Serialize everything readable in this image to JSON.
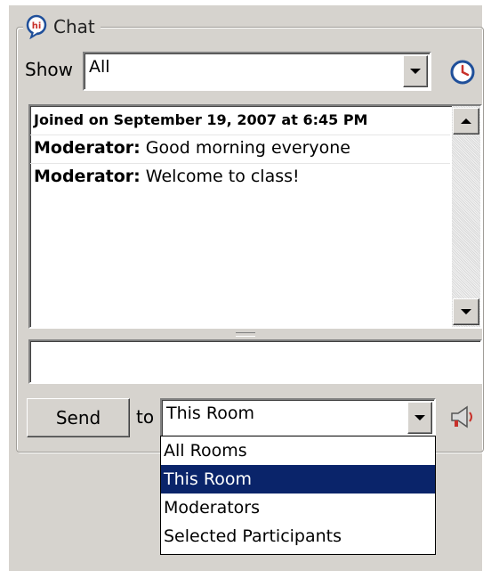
{
  "chat": {
    "title": "Chat",
    "show_label": "Show",
    "filter_selected": "All",
    "messages": [
      {
        "text": "Joined on September 19, 2007 at 6:45 PM"
      },
      {
        "sender": "Moderator:",
        "text": "Good morning everyone"
      },
      {
        "sender": "Moderator:",
        "text": "Welcome to class!"
      }
    ],
    "input_value": "",
    "send_label": "Send",
    "to_label": "to",
    "recipient_selected": "This Room",
    "recipient_options": [
      "All Rooms",
      "This Room",
      "Moderators",
      "Selected Participants"
    ],
    "recipient_highlighted_index": 1
  },
  "icons": {
    "title_icon": "chat-bubble-icon",
    "history": "clock-icon",
    "broadcast": "megaphone-icon"
  },
  "colors": {
    "panel_bg": "#d6d3ce",
    "selection_bg": "#0a246a",
    "selection_fg": "#ffffff",
    "accent_blue": "#1f4f9a",
    "accent_red": "#c8312b"
  }
}
